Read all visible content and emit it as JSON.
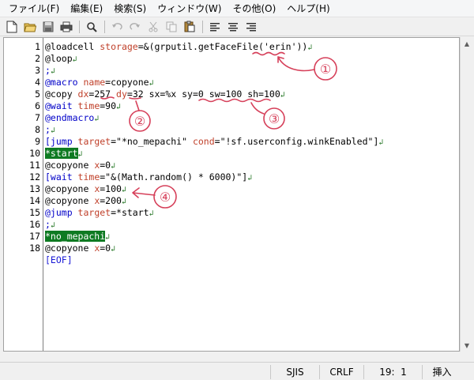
{
  "menu": {
    "file": "ファイル(F)",
    "edit": "編集(E)",
    "search": "検索(S)",
    "window": "ウィンドウ(W)",
    "other": "その他(O)",
    "help": "ヘルプ(H)"
  },
  "toolbar": {
    "icons": [
      "new-file-icon",
      "open-folder-icon",
      "save-icon",
      "print-icon",
      "find-icon",
      "undo-icon",
      "redo-icon",
      "cut-icon",
      "copy-icon",
      "paste-icon",
      "align-left-icon",
      "align-center-icon",
      "align-right-icon"
    ]
  },
  "editor": {
    "line_numbers": [
      "1",
      "2",
      "3",
      "4",
      "5",
      "6",
      "7",
      "8",
      "9",
      "10",
      "11",
      "12",
      "13",
      "14",
      "15",
      "16",
      "17",
      "18"
    ],
    "lines": [
      [
        {
          "t": "@loadcell ",
          "c": "blk"
        },
        {
          "t": "storage",
          "c": "attr"
        },
        {
          "t": "=&(grputil.getFaceFile('erin'))",
          "c": "blk"
        }
      ],
      [
        {
          "t": "@loop",
          "c": "blk"
        }
      ],
      [
        {
          "t": ";",
          "c": "kw"
        }
      ],
      [
        {
          "t": "@macro ",
          "c": "kw"
        },
        {
          "t": "name",
          "c": "attr"
        },
        {
          "t": "=copyone",
          "c": "blk"
        }
      ],
      [
        {
          "t": "@copy ",
          "c": "blk"
        },
        {
          "t": "dx",
          "c": "attr"
        },
        {
          "t": "=257 ",
          "c": "blk"
        },
        {
          "t": "dy",
          "c": "attr"
        },
        {
          "t": "=32 sx=%x sy=0 sw=100 sh=100",
          "c": "blk"
        }
      ],
      [
        {
          "t": "@wait ",
          "c": "kw"
        },
        {
          "t": "time",
          "c": "attr"
        },
        {
          "t": "=90",
          "c": "blk"
        }
      ],
      [
        {
          "t": "@endmacro",
          "c": "kw"
        }
      ],
      [
        {
          "t": ";",
          "c": "kw"
        }
      ],
      [
        {
          "t": "[jump ",
          "c": "kw"
        },
        {
          "t": "target",
          "c": "attr"
        },
        {
          "t": "=\"*no_mepachi\" ",
          "c": "blk"
        },
        {
          "t": "cond",
          "c": "attr"
        },
        {
          "t": "=\"!sf.userconfig.winkEnabled\"]",
          "c": "blk"
        }
      ],
      [
        {
          "t": "*start",
          "c": "lbl"
        }
      ],
      [
        {
          "t": "@copyone ",
          "c": "blk"
        },
        {
          "t": "x",
          "c": "attr"
        },
        {
          "t": "=0",
          "c": "blk"
        }
      ],
      [
        {
          "t": "[wait ",
          "c": "kw"
        },
        {
          "t": "time",
          "c": "attr"
        },
        {
          "t": "=\"&(Math.random() * 6000)\"]",
          "c": "blk"
        }
      ],
      [
        {
          "t": "@copyone ",
          "c": "blk"
        },
        {
          "t": "x",
          "c": "attr"
        },
        {
          "t": "=100",
          "c": "blk"
        }
      ],
      [
        {
          "t": "@copyone ",
          "c": "blk"
        },
        {
          "t": "x",
          "c": "attr"
        },
        {
          "t": "=200",
          "c": "blk"
        }
      ],
      [
        {
          "t": "@jump ",
          "c": "kw"
        },
        {
          "t": "target",
          "c": "attr"
        },
        {
          "t": "=*start",
          "c": "blk"
        }
      ],
      [
        {
          "t": ";",
          "c": "kw"
        }
      ],
      [
        {
          "t": "*no_mepachi",
          "c": "lbl"
        }
      ],
      [
        {
          "t": "@copyone ",
          "c": "blk"
        },
        {
          "t": "x",
          "c": "attr"
        },
        {
          "t": "=0",
          "c": "blk"
        }
      ]
    ],
    "eof_marker": "[EOF]",
    "eol_glyph": "↲"
  },
  "annotations": {
    "labels": [
      "①",
      "②",
      "③",
      "④"
    ],
    "color": "#d6405a"
  },
  "status": {
    "encoding": "SJIS",
    "line_ending": "CRLF",
    "position": "19:  1",
    "mode": "挿入"
  },
  "colors": {
    "keyword": "#0000c8",
    "attribute": "#c0402a",
    "label_bg": "#0e7a22",
    "eol": "#2b7a2b",
    "eof": "#1a1ad6"
  }
}
